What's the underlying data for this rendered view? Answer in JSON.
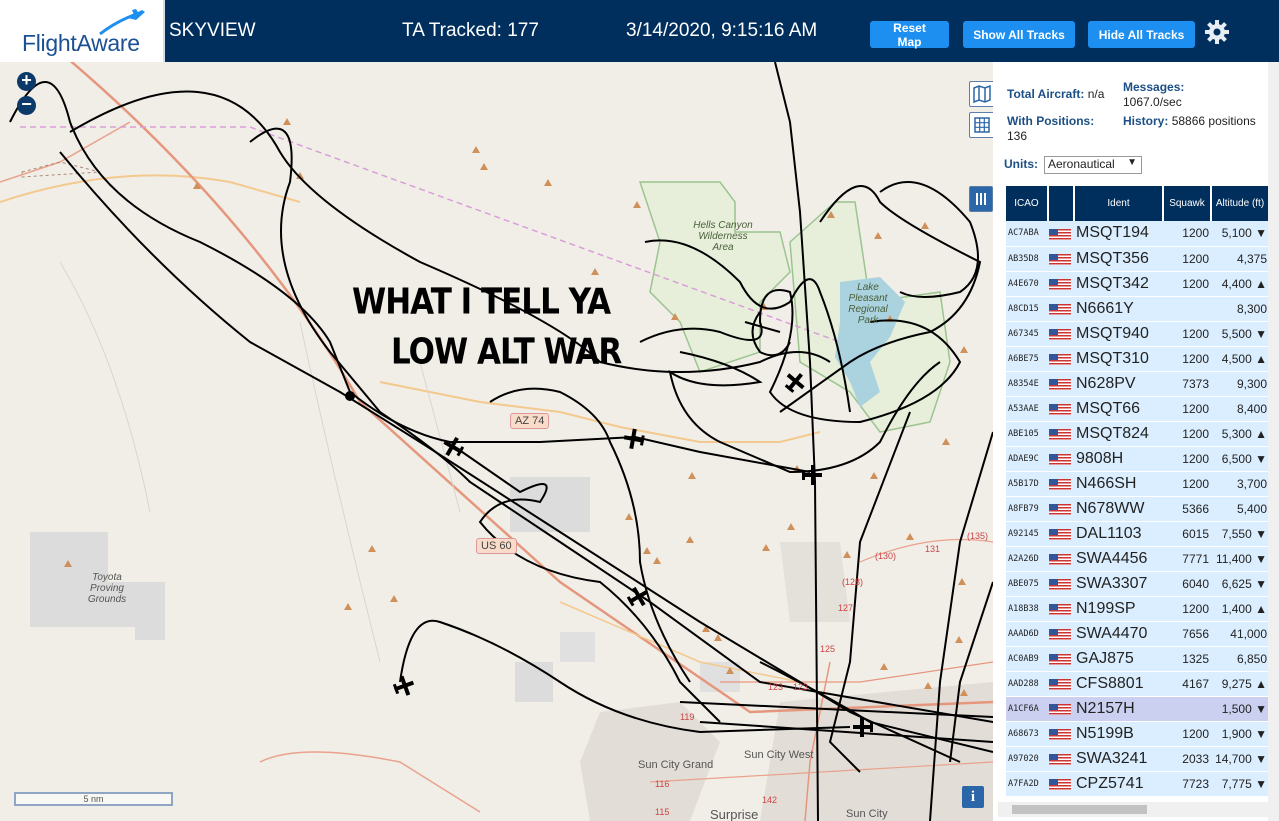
{
  "header": {
    "logo_text": "FlightAware",
    "app_title": "SKYVIEW",
    "tracked": "TA Tracked: 177",
    "datetime": "3/14/2020, 9:15:16 AM",
    "reset_label": "Reset Map",
    "show_label": "Show All Tracks",
    "hide_label": "Hide All Tracks"
  },
  "map": {
    "zoom_in": "+",
    "zoom_out": "−",
    "overlay_line1": "WHAT I TELL YA",
    "overlay_line2": "LOW ALT WAR",
    "labels": {
      "hells_canyon": "Hells Canyon Wilderness Area",
      "lake_pleasant": "Lake Pleasant Regional Park",
      "toyota": "Toyota Proving Grounds",
      "az74": "AZ 74",
      "us60": "US 60",
      "sun_city_grand": "Sun City Grand",
      "sun_city_west": "Sun City West",
      "surprise": "Surprise",
      "sun_city": "Sun City"
    },
    "road_numbers": [
      "(130)",
      "131",
      "(135)",
      "(128)",
      "127",
      "125",
      "123",
      "123",
      "119",
      "116",
      "115",
      "142"
    ],
    "scale": "5 nm",
    "info": "i"
  },
  "stats": {
    "total_label": "Total Aircraft:",
    "total_value": "n/a",
    "messages_label": "Messages:",
    "messages_value": "1067.0/sec",
    "positions_label": "With Positions:",
    "positions_value": "136",
    "history_label": "History:",
    "history_value": "58866 positions"
  },
  "units": {
    "label": "Units:",
    "selected": "Aeronautical"
  },
  "table": {
    "headers": [
      "ICAO",
      "",
      "Ident",
      "Squawk",
      "Altitude (ft)"
    ],
    "rows": [
      {
        "icao": "AC7ABA",
        "ident": "MSQT194",
        "squawk": "1200",
        "alt": "5,100 ▼"
      },
      {
        "icao": "AB35D8",
        "ident": "MSQT356",
        "squawk": "1200",
        "alt": "4,375"
      },
      {
        "icao": "A4E670",
        "ident": "MSQT342",
        "squawk": "1200",
        "alt": "4,400 ▲"
      },
      {
        "icao": "A8CD15",
        "ident": "N6661Y",
        "squawk": "",
        "alt": "8,300"
      },
      {
        "icao": "A67345",
        "ident": "MSQT940",
        "squawk": "1200",
        "alt": "5,500 ▼"
      },
      {
        "icao": "A6BE75",
        "ident": "MSQT310",
        "squawk": "1200",
        "alt": "4,500 ▲"
      },
      {
        "icao": "A8354E",
        "ident": "N628PV",
        "squawk": "7373",
        "alt": "9,300"
      },
      {
        "icao": "A53AAE",
        "ident": "MSQT66",
        "squawk": "1200",
        "alt": "8,400"
      },
      {
        "icao": "ABE105",
        "ident": "MSQT824",
        "squawk": "1200",
        "alt": "5,300 ▲"
      },
      {
        "icao": "ADAE9C",
        "ident": "9808H",
        "squawk": "1200",
        "alt": "6,500 ▼"
      },
      {
        "icao": "A5B17D",
        "ident": "N466SH",
        "squawk": "1200",
        "alt": "3,700"
      },
      {
        "icao": "A8FB79",
        "ident": "N678WW",
        "squawk": "5366",
        "alt": "5,400"
      },
      {
        "icao": "A92145",
        "ident": "DAL1103",
        "squawk": "6015",
        "alt": "7,550 ▼"
      },
      {
        "icao": "A2A26D",
        "ident": "SWA4456",
        "squawk": "7771",
        "alt": "11,400 ▼"
      },
      {
        "icao": "ABE075",
        "ident": "SWA3307",
        "squawk": "6040",
        "alt": "6,625 ▼"
      },
      {
        "icao": "A18B38",
        "ident": "N199SP",
        "squawk": "1200",
        "alt": "1,400 ▲"
      },
      {
        "icao": "AAAD6D",
        "ident": "SWA4470",
        "squawk": "7656",
        "alt": "41,000"
      },
      {
        "icao": "AC0AB9",
        "ident": "GAJ875",
        "squawk": "1325",
        "alt": "6,850"
      },
      {
        "icao": "AAD288",
        "ident": "CFS8801",
        "squawk": "4167",
        "alt": "9,275 ▲"
      },
      {
        "icao": "A1CF6A",
        "ident": "N2157H",
        "squawk": "",
        "alt": "1,500 ▼"
      },
      {
        "icao": "A68673",
        "ident": "N5199B",
        "squawk": "1200",
        "alt": "1,900 ▼"
      },
      {
        "icao": "A97020",
        "ident": "SWA3241",
        "squawk": "2033",
        "alt": "14,700 ▼"
      },
      {
        "icao": "A7FA2D",
        "ident": "CPZ5741",
        "squawk": "7723",
        "alt": "7,775 ▼"
      }
    ],
    "selected_row": 19
  },
  "colors": {
    "header_bg": "#002f5d",
    "button": "#1d8ff0",
    "row_bg": "#dbeeff",
    "row_selected": "#cbd0f0"
  }
}
